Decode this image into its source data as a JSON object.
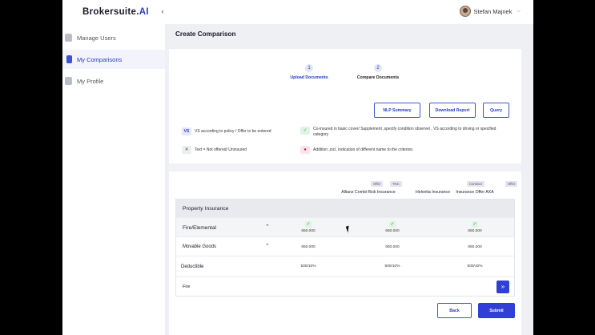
{
  "brand": {
    "name": "Brokersuite.",
    "suffix": "AI"
  },
  "sidebar": {
    "collapse_icon": "chevron-left-icon",
    "items": [
      {
        "label": "Manage Users",
        "icon": "users-icon",
        "active": false
      },
      {
        "label": "My Comparisons",
        "icon": "document-icon",
        "active": true
      },
      {
        "label": "My Profile",
        "icon": "profile-icon",
        "active": false
      }
    ]
  },
  "user": {
    "name": "Stefan Majnek"
  },
  "page": {
    "title": "Create Comparison"
  },
  "steps": [
    {
      "num": "1",
      "label": "Upload Documents"
    },
    {
      "num": "2",
      "label": "Compare Documents"
    }
  ],
  "actions": {
    "nlp": "NLP Summary",
    "download": "Download Report",
    "query": "Query"
  },
  "legend": [
    {
      "icon": "VS",
      "text": "VS according to policy / Offer to be entered"
    },
    {
      "icon": "✓",
      "text": "Co-insured in basic cover/ Supplement ,specify condition observel , VS according to driving or specified category"
    },
    {
      "icon": "✕",
      "text": "Text = Not offered/ Uninsured"
    },
    {
      "icon": "●",
      "text": "Addition ,incl, indication of different name to the criterion."
    }
  ],
  "columns": [
    {
      "name": "Allianz Combi Risk Insurance",
      "badges": [
        "Offer",
        "TNC"
      ]
    },
    {
      "name": "Helvetia Insurance",
      "badges": [
        "Contract"
      ]
    },
    {
      "name": "Insurance Offer AXA",
      "badges": [
        "Offer"
      ]
    }
  ],
  "table": {
    "section": "Property Insurance",
    "rows": [
      {
        "label": "Fire/Elemental",
        "values": [
          "650.000",
          "650.000",
          "650.000"
        ],
        "checked": true
      },
      {
        "label": "Movable Goods",
        "values": [
          "650.000",
          "650.000",
          "650.000"
        ],
        "checked": false
      },
      {
        "label": "Deductible",
        "values": [
          "500/10%",
          "500/10%",
          "500/10%"
        ],
        "checked": false
      }
    ],
    "footer_label": "Fire"
  },
  "footer": {
    "back": "Back",
    "submit": "Submit"
  },
  "colors": {
    "accent": "#2f3fd7",
    "check": "#2f9b45",
    "dot": "#d0112b"
  }
}
